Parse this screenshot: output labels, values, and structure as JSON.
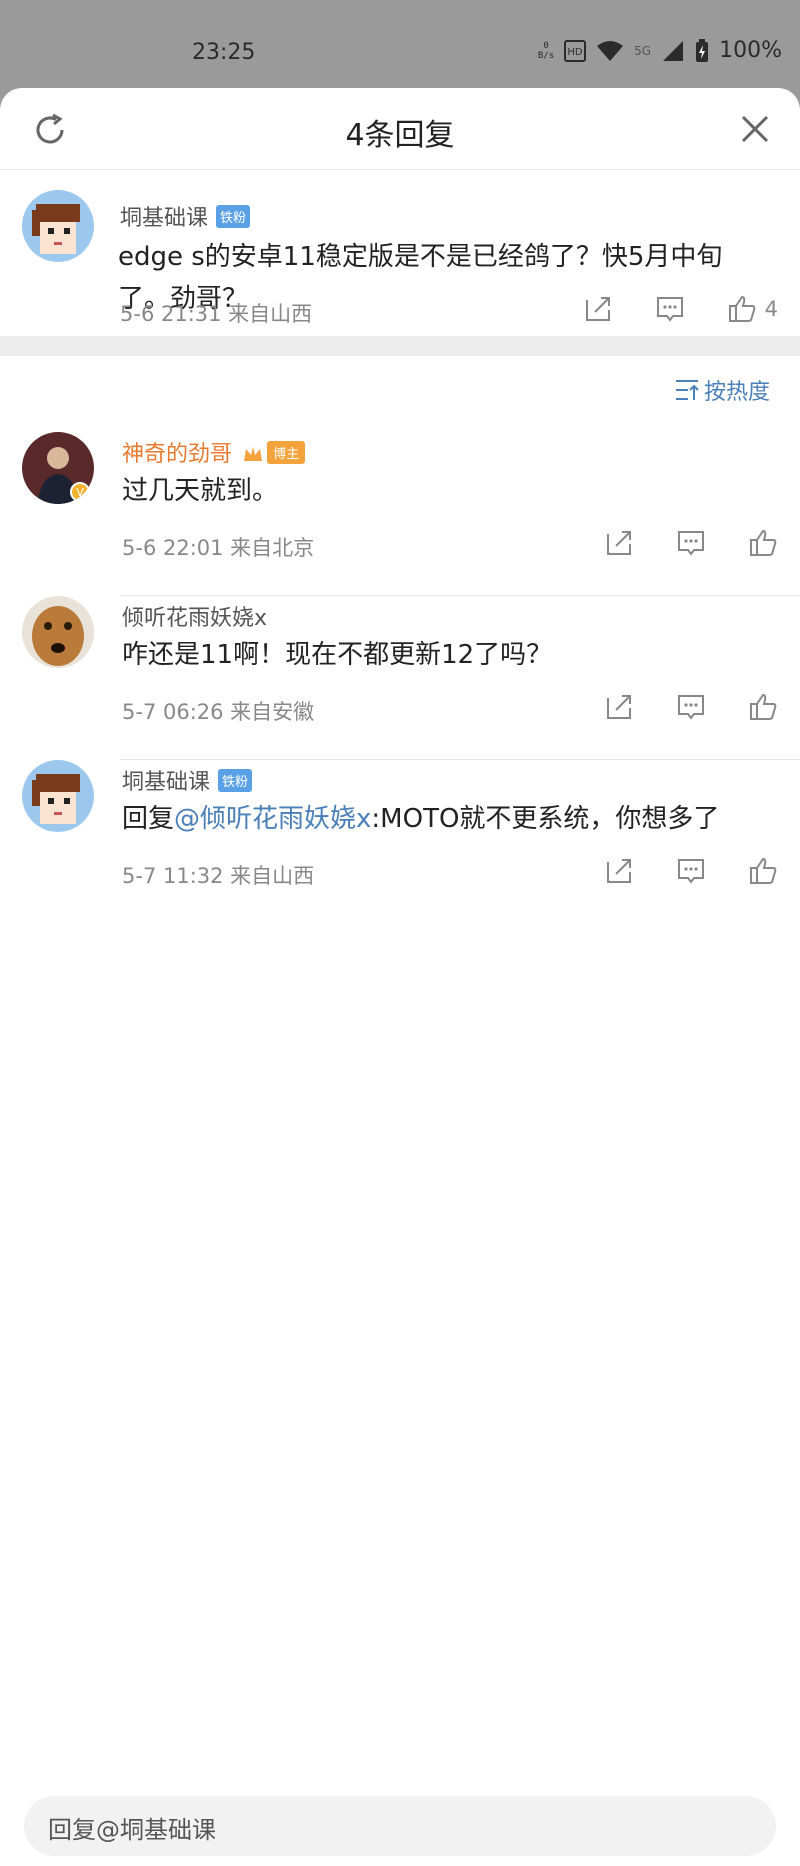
{
  "status_bar": {
    "time": "23:25",
    "net_speed_value": "0",
    "net_speed_unit": "B/s",
    "network_label": "5G",
    "battery": "100%"
  },
  "header": {
    "title": "4条回复"
  },
  "root_comment": {
    "username": "垌基础课",
    "badge": "铁粉",
    "text": "edge s的安卓11稳定版是不是已经鸽了？快5月中旬了。劲哥？",
    "meta": "5-6 21:31  来自山西",
    "like_count": "4"
  },
  "sort": {
    "label": "按热度"
  },
  "replies": [
    {
      "username": "神奇的劲哥",
      "badge": "博主",
      "text": "过几天就到。",
      "meta": "5-6 22:01  来自北京"
    },
    {
      "username": "倾听花雨妖娆x",
      "text": "咋还是11啊！现在不都更新12了吗？",
      "meta": "5-7 06:26  来自安徽"
    },
    {
      "username": "垌基础课",
      "badge": "铁粉",
      "text_prefix": "回复",
      "mention": "@倾听花雨妖娆x",
      "text_suffix": ":MOTO就不更系统，你想多了",
      "meta": "5-7 11:32  来自山西"
    }
  ],
  "reply_input": {
    "placeholder": "回复@垌基础课"
  },
  "colors": {
    "accent_blue": "#4a7fb8",
    "host_orange": "#e87a2f",
    "fan_badge": "#5aa0e6"
  }
}
